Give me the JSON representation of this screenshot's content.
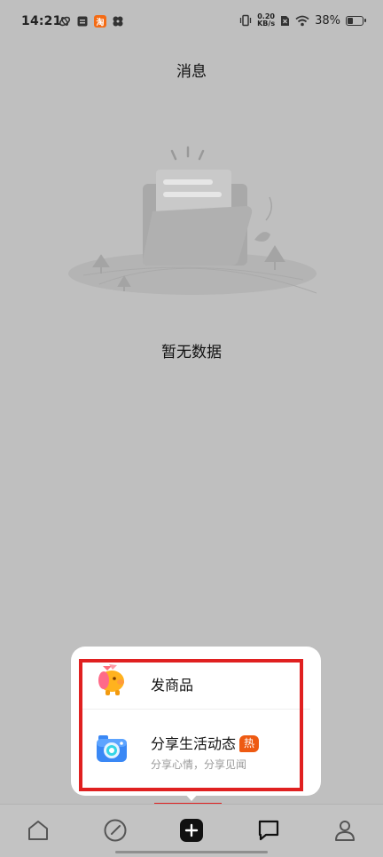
{
  "status_bar": {
    "time": "14:21",
    "net_speed_value": "0.20",
    "net_speed_unit": "KB/s",
    "battery_percent": "38%",
    "battery_level": 0.38,
    "taobao_glyph": "淘"
  },
  "page": {
    "title": "消息",
    "empty_text": "暂无数据"
  },
  "popup": {
    "items": [
      {
        "label": "发商品",
        "icon": "pig-gift-icon"
      },
      {
        "label": "分享生活动态",
        "badge": "热",
        "subtitle": "分享心情，分享见闻",
        "icon": "camera-icon"
      }
    ]
  },
  "nav": {
    "items": [
      "home-icon",
      "discover-icon",
      "publish-icon",
      "message-icon",
      "profile-icon"
    ]
  },
  "colors": {
    "background_dim": "#bfbfbf",
    "highlight": "#e02020",
    "hot_badge": "#ee5a12"
  }
}
